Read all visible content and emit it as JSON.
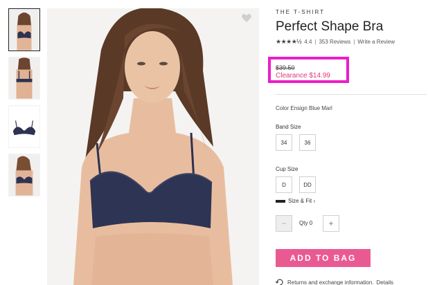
{
  "thumbnails": [
    {
      "name": "front view",
      "active": true
    },
    {
      "name": "back view",
      "active": false
    },
    {
      "name": "product flat",
      "active": false
    },
    {
      "name": "side view",
      "active": false
    }
  ],
  "product": {
    "brand": "THE T-SHIRT",
    "title": "Perfect Shape Bra",
    "stars": "★★★★½",
    "rating": "4.4",
    "reviews": "353 Reviews",
    "write_review": "Write a Review",
    "original_price": "$39.50",
    "sale_price": "Clearance $14.99",
    "color": "Color Ensign Blue Marl"
  },
  "options": {
    "band_label": "Band Size",
    "band_sizes": [
      "34",
      "36"
    ],
    "cup_label": "Cup Size",
    "cup_sizes": [
      "D",
      "DD"
    ],
    "size_fit": "Size & Fit ›"
  },
  "quantity": {
    "label": "Qty",
    "value": "0",
    "minus": "−",
    "plus": "+"
  },
  "actions": {
    "add_to_bag": "ADD TO BAG",
    "returns_text": "Returns and exchange information.",
    "details_link": "Details"
  },
  "colors": {
    "highlight": "#ec1dc8",
    "sale": "#e0367a",
    "button": "#ea5a92"
  },
  "icons": {
    "favorite": "heart-icon",
    "returns": "returns-icon"
  }
}
